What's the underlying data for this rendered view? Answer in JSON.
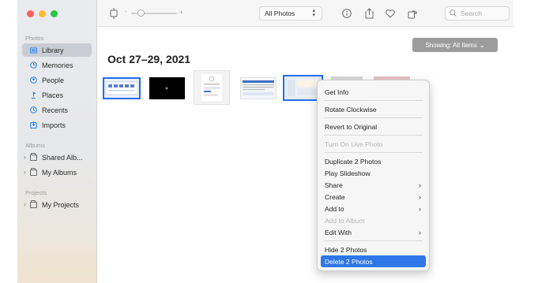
{
  "window": {
    "traffic_lights": [
      "close",
      "minimize",
      "zoom"
    ]
  },
  "sidebar": {
    "sections": {
      "photos": "Photos",
      "albums": "Albums",
      "projects": "Projects"
    },
    "photos_items": [
      {
        "label": "Library",
        "icon": "library-icon",
        "selected": true
      },
      {
        "label": "Memories",
        "icon": "memories-icon"
      },
      {
        "label": "People",
        "icon": "people-icon"
      },
      {
        "label": "Places",
        "icon": "places-icon"
      },
      {
        "label": "Recents",
        "icon": "recents-icon"
      },
      {
        "label": "Imports",
        "icon": "imports-icon"
      }
    ],
    "albums_items": [
      {
        "label": "Shared Alb...",
        "icon": "shared-album-icon"
      },
      {
        "label": "My Albums",
        "icon": "folder-icon"
      }
    ],
    "projects_items": [
      {
        "label": "My Projects",
        "icon": "folder-icon"
      }
    ]
  },
  "toolbar": {
    "zoom_min": "-",
    "zoom_max": "+",
    "view_select": "All Photos",
    "search_placeholder": "Search",
    "icons": [
      "rotate-icon",
      "info-icon",
      "share-icon",
      "favorite-icon",
      "rotate-clockwise-icon",
      "search-icon"
    ]
  },
  "main": {
    "showing_label": "Showing: All Items",
    "date_title": "Oct 27–29, 2021"
  },
  "context_menu": {
    "items": [
      {
        "label": "Get Info"
      },
      {
        "label": "Rotate Clockwise"
      },
      {
        "label": "Revert to Original"
      },
      {
        "label": "Turn On Live Photo",
        "disabled": true
      },
      {
        "label": "Duplicate 2 Photos"
      },
      {
        "label": "Play Slideshow"
      },
      {
        "label": "Share",
        "submenu": true
      },
      {
        "label": "Create",
        "submenu": true
      },
      {
        "label": "Add to",
        "submenu": true
      },
      {
        "label": "Add to Album",
        "disabled": true
      },
      {
        "label": "Edit With",
        "submenu": true
      },
      {
        "label": "Hide 2 Photos"
      },
      {
        "label": "Delete 2 Photos",
        "highlighted": true
      }
    ]
  },
  "colors": {
    "accent": "#2e77e8",
    "selection_border": "#1e6ef2",
    "traffic_red": "#fe5f57",
    "traffic_yellow": "#febc2e",
    "traffic_green": "#28c840"
  }
}
